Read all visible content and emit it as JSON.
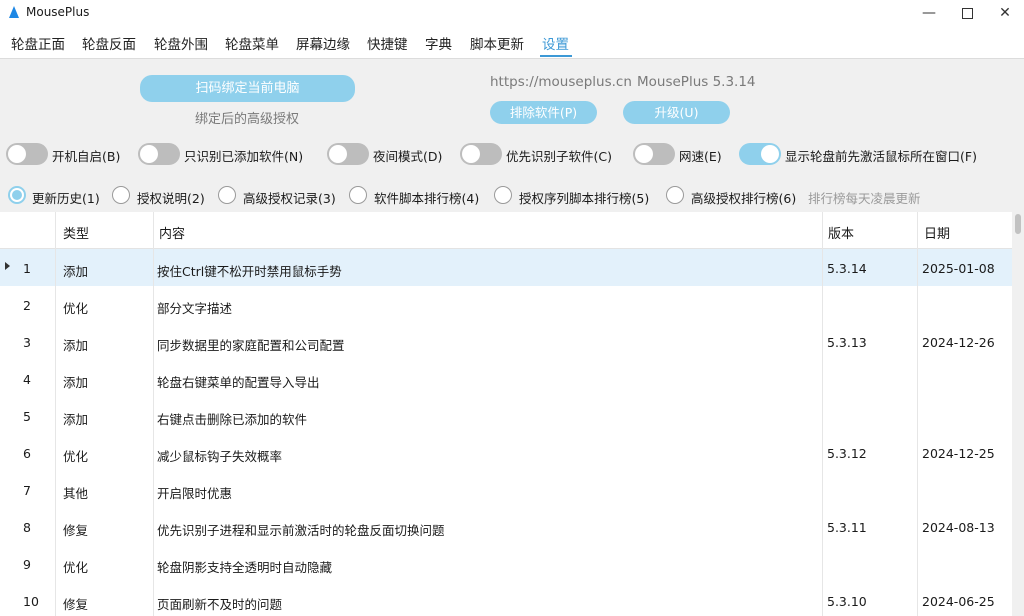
{
  "window": {
    "title": "MousePlus",
    "minimize": "—",
    "close": "✕"
  },
  "tabs": [
    {
      "label": "轮盘正面"
    },
    {
      "label": "轮盘反面"
    },
    {
      "label": "轮盘外围"
    },
    {
      "label": "轮盘菜单"
    },
    {
      "label": "屏幕边缘"
    },
    {
      "label": "快捷键"
    },
    {
      "label": "字典"
    },
    {
      "label": "脚本更新"
    },
    {
      "label": "设置"
    }
  ],
  "active_tab": "设置",
  "top": {
    "bind_button": "扫码绑定当前电脑",
    "bind_caption": "绑定后的高级授权",
    "url": "https://mouseplus.cn",
    "version": "MousePlus 5.3.14",
    "exclude_button": "排除软件(P)",
    "upgrade_button": "升级(U)"
  },
  "toggles": [
    {
      "label": "开机自启(B)",
      "on": false
    },
    {
      "label": "只识别已添加软件(N)",
      "on": false
    },
    {
      "label": "夜间模式(D)",
      "on": false
    },
    {
      "label": "优先识别子软件(C)",
      "on": false
    },
    {
      "label": "网速(E)",
      "on": false
    },
    {
      "label": "显示轮盘前先激活鼠标所在窗口(F)",
      "on": true
    }
  ],
  "radios": [
    {
      "label": "更新历史(1)",
      "on": true
    },
    {
      "label": "授权说明(2)",
      "on": false
    },
    {
      "label": "高级授权记录(3)",
      "on": false
    },
    {
      "label": "软件脚本排行榜(4)",
      "on": false
    },
    {
      "label": "授权序列脚本排行榜(5)",
      "on": false
    },
    {
      "label": "高级授权排行榜(6)",
      "on": false
    }
  ],
  "radio_note": "排行榜每天凌晨更新",
  "table": {
    "columns": [
      "类型",
      "内容",
      "版本",
      "日期"
    ],
    "rows": [
      {
        "no": "1",
        "type": "添加",
        "content": "按住Ctrl键不松开时禁用鼠标手势",
        "version": "5.3.14",
        "date": "2025-01-08"
      },
      {
        "no": "2",
        "type": "优化",
        "content": "部分文字描述",
        "version": "",
        "date": ""
      },
      {
        "no": "3",
        "type": "添加",
        "content": "同步数据里的家庭配置和公司配置",
        "version": "5.3.13",
        "date": "2024-12-26"
      },
      {
        "no": "4",
        "type": "添加",
        "content": "轮盘右键菜单的配置导入导出",
        "version": "",
        "date": ""
      },
      {
        "no": "5",
        "type": "添加",
        "content": "右键点击删除已添加的软件",
        "version": "",
        "date": ""
      },
      {
        "no": "6",
        "type": "优化",
        "content": "减少鼠标钩子失效概率",
        "version": "5.3.12",
        "date": "2024-12-25"
      },
      {
        "no": "7",
        "type": "其他",
        "content": "开启限时优惠",
        "version": "",
        "date": ""
      },
      {
        "no": "8",
        "type": "修复",
        "content": "优先识别子进程和显示前激活时的轮盘反面切换问题",
        "version": "5.3.11",
        "date": "2024-08-13"
      },
      {
        "no": "9",
        "type": "优化",
        "content": "轮盘阴影支持全透明时自动隐藏",
        "version": "",
        "date": ""
      },
      {
        "no": "10",
        "type": "修复",
        "content": "页面刷新不及时的问题",
        "version": "5.3.10",
        "date": "2024-06-25"
      }
    ]
  },
  "colors": {
    "accent": "#3d99d6",
    "pill": "#8fd0ec",
    "selected_row": "#e3f1fb"
  }
}
